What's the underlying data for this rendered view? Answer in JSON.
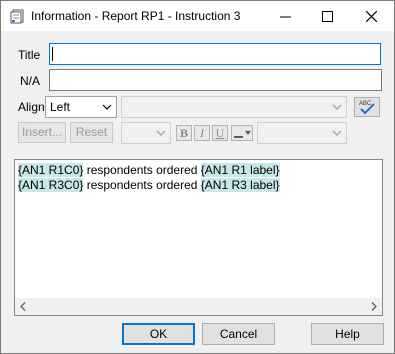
{
  "window": {
    "title": "Information - Report RP1 - Instruction 3"
  },
  "form": {
    "title_label": "Title",
    "title_value": "",
    "na_label": "N/A",
    "na_value": "",
    "align_label": "Align",
    "align_value": "Left",
    "insert_label": "Insert...",
    "reset_label": "Reset"
  },
  "format_buttons": {
    "bold": "B",
    "italic": "I",
    "underline": "U"
  },
  "editor": {
    "lines": [
      [
        {
          "text": "{AN1 R1C0}",
          "tag": true
        },
        {
          "text": " respondents ordered ",
          "tag": false
        },
        {
          "text": "{AN1 R1 label}",
          "tag": true
        }
      ],
      [
        {
          "text": "{AN1 R3C0}",
          "tag": true
        },
        {
          "text": " respondents ordered ",
          "tag": false
        },
        {
          "text": "{AN1 R3 label}",
          "tag": true
        }
      ]
    ]
  },
  "footer": {
    "ok_label": "OK",
    "cancel_label": "Cancel",
    "help_label": "Help"
  },
  "colors": {
    "accent": "#0078d7",
    "tag_highlight": "#c9e6e8"
  }
}
